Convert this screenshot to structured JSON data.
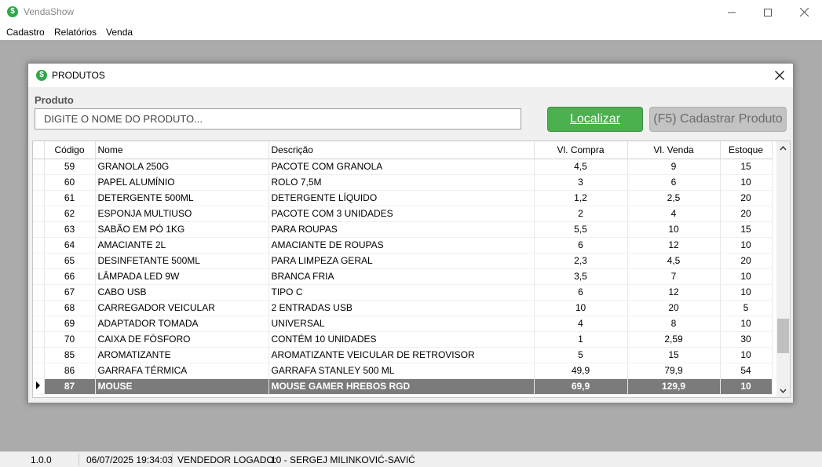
{
  "app": {
    "title": "VendaShow",
    "icon": "dollar-circle-icon"
  },
  "menu": [
    {
      "label": "Cadastro"
    },
    {
      "label": "Relatórios"
    },
    {
      "label": "Venda"
    }
  ],
  "status": {
    "version": "1.0.0",
    "datetime": "06/07/2025 19:34:03",
    "seller_label": "VENDEDOR LOGADO:",
    "seller": "10 - SERGEJ MILINKOVIĆ-SAVIĆ"
  },
  "dialog": {
    "title": "PRODUTOS",
    "field_label": "Produto",
    "search_placeholder": "DIGITE O NOME DO PRODUTO...",
    "find_button": "Localizar",
    "add_button": "(F5) Cadastrar Produto"
  },
  "grid": {
    "columns": [
      "Código",
      "Nome",
      "Descrição",
      "Vl. Compra",
      "Vl. Venda",
      "Estoque"
    ],
    "rows": [
      {
        "codigo": "59",
        "nome": "GRANOLA 250G",
        "descricao": "PACOTE COM GRANOLA",
        "compra": "4,5",
        "venda": "9",
        "estoque": "15"
      },
      {
        "codigo": "60",
        "nome": "PAPEL ALUMÍNIO",
        "descricao": "ROLO 7,5M",
        "compra": "3",
        "venda": "6",
        "estoque": "10"
      },
      {
        "codigo": "61",
        "nome": "DETERGENTE 500ML",
        "descricao": "DETERGENTE LÍQUIDO",
        "compra": "1,2",
        "venda": "2,5",
        "estoque": "20"
      },
      {
        "codigo": "62",
        "nome": "ESPONJA MULTIUSO",
        "descricao": "PACOTE COM 3 UNIDADES",
        "compra": "2",
        "venda": "4",
        "estoque": "20"
      },
      {
        "codigo": "63",
        "nome": "SABÃO EM PÓ 1KG",
        "descricao": "PARA ROUPAS",
        "compra": "5,5",
        "venda": "10",
        "estoque": "15"
      },
      {
        "codigo": "64",
        "nome": "AMACIANTE 2L",
        "descricao": "AMACIANTE DE ROUPAS",
        "compra": "6",
        "venda": "12",
        "estoque": "10"
      },
      {
        "codigo": "65",
        "nome": "DESINFETANTE 500ML",
        "descricao": "PARA LIMPEZA GERAL",
        "compra": "2,3",
        "venda": "4,5",
        "estoque": "20"
      },
      {
        "codigo": "66",
        "nome": "LÂMPADA LED 9W",
        "descricao": "BRANCA FRIA",
        "compra": "3,5",
        "venda": "7",
        "estoque": "10"
      },
      {
        "codigo": "67",
        "nome": "CABO USB",
        "descricao": "TIPO C",
        "compra": "6",
        "venda": "12",
        "estoque": "10"
      },
      {
        "codigo": "68",
        "nome": "CARREGADOR VEICULAR",
        "descricao": "2 ENTRADAS USB",
        "compra": "10",
        "venda": "20",
        "estoque": "5"
      },
      {
        "codigo": "69",
        "nome": "ADAPTADOR TOMADA",
        "descricao": "UNIVERSAL",
        "compra": "4",
        "venda": "8",
        "estoque": "10"
      },
      {
        "codigo": "70",
        "nome": "CAIXA DE FÓSFORO",
        "descricao": "CONTÉM 10 UNIDADES",
        "compra": "1",
        "venda": "2,59",
        "estoque": "30"
      },
      {
        "codigo": "85",
        "nome": "AROMATIZANTE",
        "descricao": "AROMATIZANTE VEICULAR DE RETROVISOR",
        "compra": "5",
        "venda": "15",
        "estoque": "10"
      },
      {
        "codigo": "86",
        "nome": "GARRAFA TÉRMICA",
        "descricao": "GARRAFA STANLEY 500 ML",
        "compra": "49,9",
        "venda": "79,9",
        "estoque": "54"
      },
      {
        "codigo": "87",
        "nome": "MOUSE",
        "descricao": "MOUSE GAMER HREBOS RGD",
        "compra": "69,9",
        "venda": "129,9",
        "estoque": "10",
        "selected": true
      }
    ]
  }
}
